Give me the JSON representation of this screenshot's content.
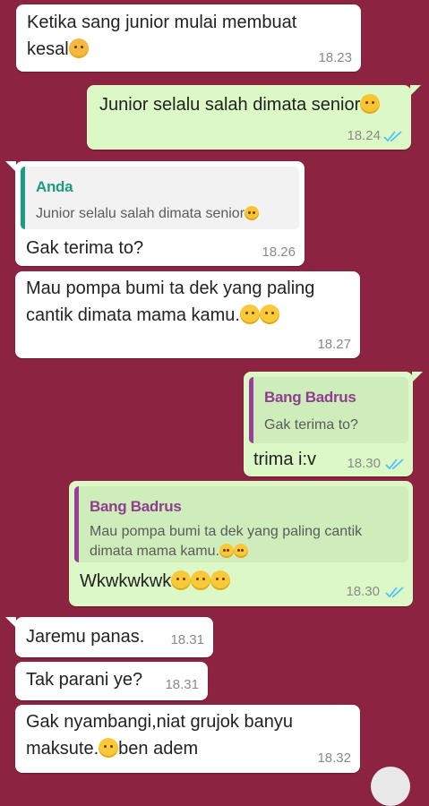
{
  "messages": [
    {
      "text": "Ketika sang junior mulai membuat",
      "text2": "kesal",
      "time": "18.23"
    },
    {
      "text": "Junior selalu salah dimata senior",
      "time": "18.24"
    },
    {
      "quote_author": "Anda",
      "quote_text": "Junior selalu salah dimata senior",
      "text": "Gak terima to?",
      "time": "18.26"
    },
    {
      "text": "Mau pompa bumi ta dek yang paling",
      "text2": "cantik dimata mama kamu.",
      "time": "18.27"
    },
    {
      "quote_author": "Bang Badrus",
      "quote_text": "Gak terima to?",
      "text": "trima i:v",
      "time": "18.30"
    },
    {
      "quote_author": "Bang Badrus",
      "quote_text": "Mau pompa bumi ta dek yang paling cantik",
      "quote_text2": "dimata mama kamu.",
      "text": "Wkwkwkwk",
      "time": "18.30"
    },
    {
      "text": "Jaremu panas.",
      "time": "18.31"
    },
    {
      "text": "Tak parani ye?",
      "time": "18.31"
    },
    {
      "text": "Gak nyambangi,niat grujok banyu",
      "text2": "maksute.",
      "text3": "ben adem",
      "time": "18.32"
    }
  ],
  "colors": {
    "background": "#8c2340",
    "incoming": "#ffffff",
    "outgoing": "#dcf8c6",
    "read_ticks": "#4fc3f7"
  }
}
